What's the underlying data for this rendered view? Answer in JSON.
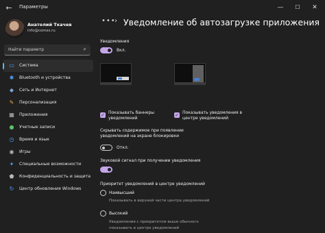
{
  "window": {
    "title": "Параметры",
    "back_glyph": "←",
    "min_glyph": "—",
    "max_glyph": "☐",
    "close_glyph": "✕"
  },
  "user": {
    "name": "Анатолий Ткачев",
    "email": "info@comss.ru"
  },
  "search": {
    "placeholder": "Найти параметр",
    "icon": "search-icon"
  },
  "sidebar": {
    "active_color": "#4cc2ff",
    "items": [
      {
        "label": "Система",
        "icon": "monitor-icon",
        "glyph": "▭",
        "color": "#4aa3ff",
        "active": true
      },
      {
        "label": "Bluetooth и устройства",
        "icon": "bluetooth-icon",
        "glyph": "✱",
        "color": "#4aa3ff"
      },
      {
        "label": "Сеть и Интернет",
        "icon": "network-icon",
        "glyph": "◆",
        "color": "#7aa7d6"
      },
      {
        "label": "Персонализация",
        "icon": "brush-icon",
        "glyph": "✎",
        "color": "#e6a84b"
      },
      {
        "label": "Приложения",
        "icon": "apps-icon",
        "glyph": "▦",
        "color": "#b9b9b9"
      },
      {
        "label": "Учетные записи",
        "icon": "person-icon",
        "glyph": "●",
        "color": "#5ac26a"
      },
      {
        "label": "Время и язык",
        "icon": "globe-clock-icon",
        "glyph": "◷",
        "color": "#4aa3ff"
      },
      {
        "label": "Игры",
        "icon": "gamepad-icon",
        "glyph": "◉",
        "color": "#b9b9b9"
      },
      {
        "label": "Специальные возможности",
        "icon": "accessibility-icon",
        "glyph": "✦",
        "color": "#4aa3ff"
      },
      {
        "label": "Конфиденциальность и защита",
        "icon": "shield-icon",
        "glyph": "⬟",
        "color": "#b9b9b9"
      },
      {
        "label": "Центр обновления Windows",
        "icon": "update-icon",
        "glyph": "↻",
        "color": "#4aa3ff"
      }
    ]
  },
  "breadcrumb": {
    "more": "•••",
    "separator": "›"
  },
  "page": {
    "title": "Уведомление об автозагрузке приложения",
    "notifications_label": "Уведомления",
    "notifications_state": "Вкл.",
    "show_banners_label": "Показывать баннеры уведомлений",
    "show_in_center_label": "Показывать уведомления в центре уведомлений",
    "hide_on_lock_label": "Скрывать содержимое при появлении уведомлений на экране блокировки",
    "hide_on_lock_state": "Откл.",
    "sound_label": "Звуковой сигнал при получении уведомления",
    "priority_heading": "Приоритет уведомлений в центре уведомлений",
    "priority_options": [
      {
        "label": "Наивысший",
        "desc": "Показывать в верхней части центра уведомлений"
      },
      {
        "label": "Высокий",
        "desc": "Уведомления с приоритетом выше обычного показывать в центре уведомлений"
      }
    ],
    "accent_color": "#c4a5e8",
    "check_glyph": "✓"
  }
}
